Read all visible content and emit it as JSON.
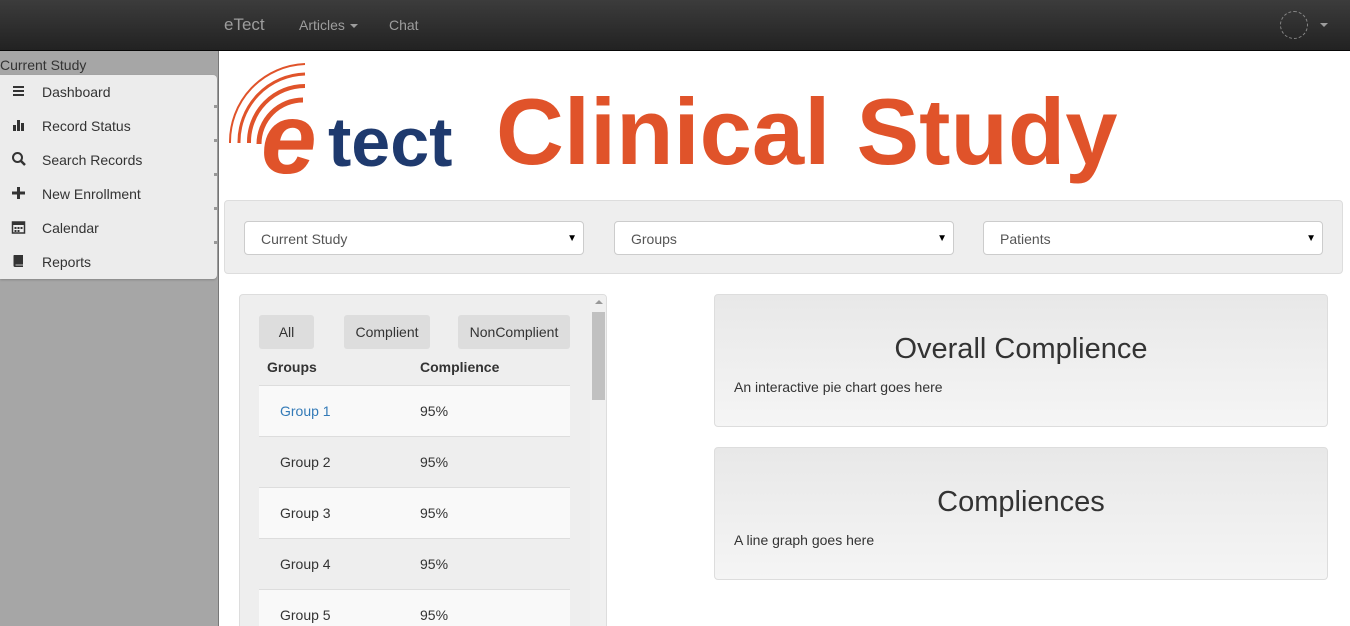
{
  "navbar": {
    "brand": "eTect",
    "articles_label": "Articles",
    "chat_label": "Chat"
  },
  "sidebar": {
    "title": "Current Study",
    "items": [
      {
        "label": "Dashboard",
        "icon": "menu-icon"
      },
      {
        "label": "Record Status",
        "icon": "bar-chart-icon"
      },
      {
        "label": "Search Records",
        "icon": "search-icon"
      },
      {
        "label": "New Enrollment",
        "icon": "plus-icon"
      },
      {
        "label": "Calendar",
        "icon": "calendar-icon"
      },
      {
        "label": "Reports",
        "icon": "book-icon"
      }
    ]
  },
  "logo": {
    "mark_letter": "e",
    "mark_text": "tect",
    "headline": "Clinical Study",
    "colors": {
      "orange": "#e0532a",
      "navy": "#1f3a6e"
    }
  },
  "filters": {
    "study": "Current Study",
    "groups": "Groups",
    "patients": "Patients"
  },
  "groups_panel": {
    "buttons": {
      "all": "All",
      "complient": "Complient",
      "noncomplient": "NonComplient"
    },
    "headers": {
      "groups": "Groups",
      "complience": "Complience"
    },
    "rows": [
      {
        "group": "Group 1",
        "value": "95%"
      },
      {
        "group": "Group 2",
        "value": "95%"
      },
      {
        "group": "Group 3",
        "value": "95%"
      },
      {
        "group": "Group 4",
        "value": "95%"
      },
      {
        "group": "Group 5",
        "value": "95%"
      }
    ]
  },
  "panels": {
    "overall": {
      "title": "Overall Complience",
      "desc": "An interactive pie chart goes here"
    },
    "compliences": {
      "title": "Compliences",
      "desc": "A line graph goes here"
    }
  }
}
